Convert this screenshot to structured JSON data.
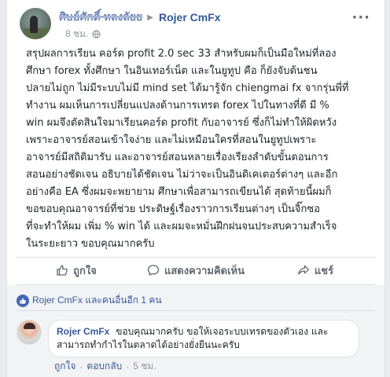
{
  "post": {
    "author_name_obscured": "ศิษย์ศักดิ์ หลงลัยย",
    "page_name": "Rojer CmFx",
    "time": "8 ชม.",
    "more_label": "···",
    "text_lines": [
      "สรุปผลการเรียน คอร์ด profit 2.0 sec 33 สำหรับผมก็เป็นมือใหม่ที่ลอง",
      "ศึกษา forex ทั้งศึกษา ในอินเทอร์เน็ต และในยูทูป คือ ก็ยังจับต้นชน",
      "ปลายไม่ถูก ไม่มีระบบไม่มี mind set ได้มารู้จัก chiengmai fx จากรุ่นพี่ที่",
      "ทำงาน ผมเห็นการเปลี่ยนแปลงด้านการเทรด forex ไปในทางที่ดี มี %",
      "win ผมจึงตัดสินใจมาเรียนคอร์ด profit กับอาจารย์ ซึ่งก็ไม่ทำให้ผิดหวัง",
      "เพราะอาจารย์สอนเข้าใจง่าย และไม่เหมือนใครที่สอนในยูทูปเพราะ",
      "อาจารย์มีสถิติมารับ และอาจารย์สอนหลายเรื่องเรียงลำดับขั้นตอนการ",
      "สอนอย่างชัดเจน อธิบายได้ชัดเจน ไม่ว่าจะเป็นอินดิเคเตอร์ต่างๆ และอีก",
      "อย่างคือ EA ซึ่งผมจะพยายาม ศึกษาเพื่อสามารถเขียนได้ สุดท้ายนี้ผมก็",
      "ขอขอบคุณอาจารย์ที่ช่วย ประดิษฐ์เรื่องราวการเรียนต่างๆ เป็นจิ๊กซอ",
      "ที่จะทำให้ผม เพิ่ม % win ได้ และผมจะหมั่นฝึกฝนจนประสบความสำเร็จ",
      "ในระยะยาว ขอบคุณมากครับ"
    ]
  },
  "actions": {
    "like": "ถูกใจ",
    "comment": "แสดงความคิดเห็น",
    "share": "แชร์"
  },
  "reactions": {
    "text": "Rojer CmFx และคนอื่นอีก 1 คน"
  },
  "comment": {
    "author": "Rojer CmFx",
    "text": "ขอบคุณมากครับ ขอให้เจอระบบเทรดของตัวเอง และ สามารถทำกำไรในตลาดได้อย่างยั่งยืนนะครับ",
    "like_label": "ถูกใจ",
    "reply_label": "ตอบกลับ",
    "time": "5 ชม."
  },
  "colors": {
    "link_blue": "#365899",
    "facebook_blue": "#4267b2",
    "secondary_text": "#90949c"
  }
}
